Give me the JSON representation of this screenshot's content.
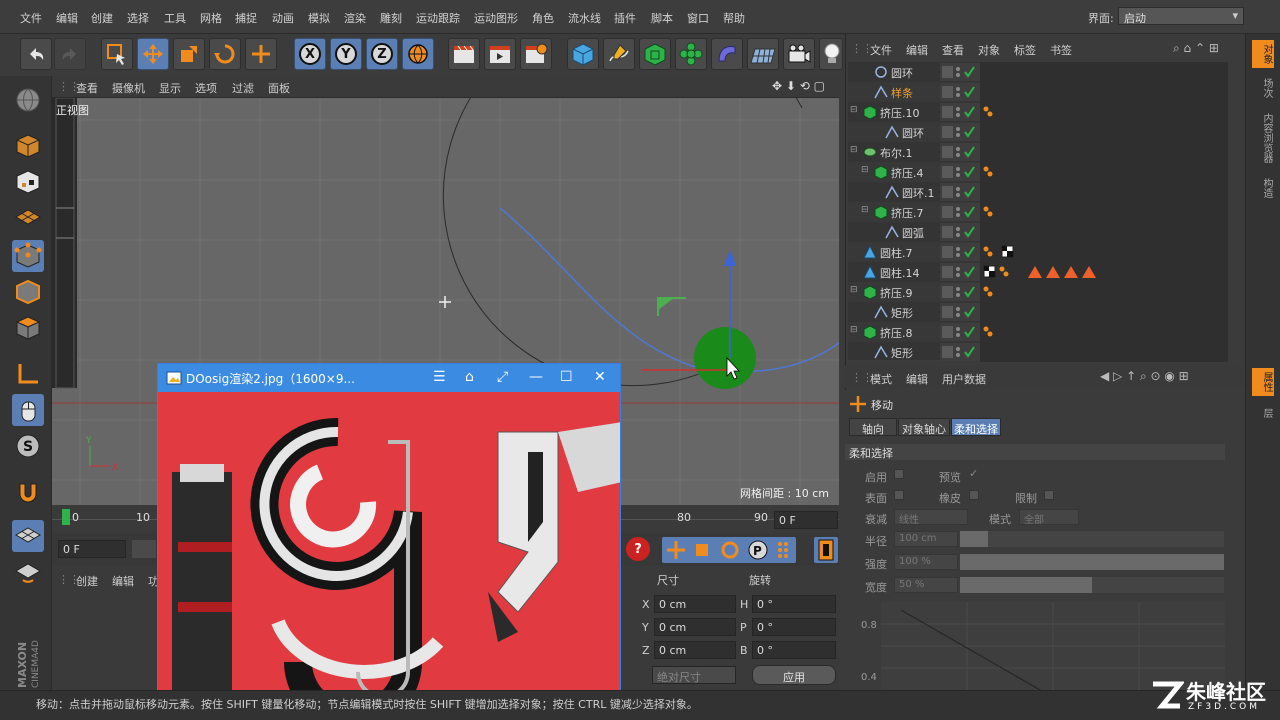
{
  "menubar": {
    "items": [
      "文件",
      "编辑",
      "创建",
      "选择",
      "工具",
      "网格",
      "捕捉",
      "动画",
      "模拟",
      "渲染",
      "雕刻",
      "运动跟踪",
      "运动图形",
      "角色",
      "流水线",
      "插件",
      "脚本",
      "窗口",
      "帮助"
    ],
    "interface_label": "界面:",
    "interface_value": "启动"
  },
  "toolbar": {
    "axes": [
      "X",
      "Y",
      "Z"
    ]
  },
  "viewport": {
    "menu": [
      "查看",
      "摄像机",
      "显示",
      "选项",
      "过滤",
      "面板"
    ],
    "view_name": "正视图",
    "grid_spacing": "网格间距 : 10 cm",
    "axis_y": "Y",
    "axis_x": "X"
  },
  "timeline": {
    "ticks": [
      "0",
      "10",
      "80",
      "90"
    ],
    "frame_field": "0 F",
    "start_field": "0 F"
  },
  "coord_manager": {
    "menu": [
      "创建",
      "编辑",
      "功"
    ],
    "col_size": "尺寸",
    "col_rotation": "旋转",
    "rows": [
      {
        "axis": "X",
        "size": "0 cm",
        "rot_axis": "H",
        "rot": "0 °"
      },
      {
        "axis": "Y",
        "size": "0 cm",
        "rot_axis": "P",
        "rot": "0 °"
      },
      {
        "axis": "Z",
        "size": "0 cm",
        "rot_axis": "B",
        "rot": "0 °"
      }
    ],
    "size_mode": "绝对尺寸",
    "apply": "应用"
  },
  "object_manager": {
    "menu": [
      "文件",
      "编辑",
      "查看",
      "对象",
      "标签",
      "书签"
    ],
    "objects": [
      {
        "name": "圆环",
        "indent": 1,
        "icon": "circle"
      },
      {
        "name": "样条",
        "indent": 1,
        "icon": "spline",
        "highlight": true
      },
      {
        "name": "挤压.10",
        "indent": 0,
        "icon": "extrude"
      },
      {
        "name": "圆环",
        "indent": 2,
        "icon": "spline"
      },
      {
        "name": "布尔.1",
        "indent": 0,
        "icon": "boole"
      },
      {
        "name": "挤压.4",
        "indent": 1,
        "icon": "extrude"
      },
      {
        "name": "圆环.1",
        "indent": 2,
        "icon": "spline"
      },
      {
        "name": "挤压.7",
        "indent": 1,
        "icon": "extrude"
      },
      {
        "name": "圆弧",
        "indent": 2,
        "icon": "spline"
      },
      {
        "name": "圆柱.7",
        "indent": 0,
        "icon": "cylinder"
      },
      {
        "name": "圆柱.14",
        "indent": 0,
        "icon": "cylinder"
      },
      {
        "name": "挤压.9",
        "indent": 0,
        "icon": "extrude"
      },
      {
        "name": "矩形",
        "indent": 1,
        "icon": "spline"
      },
      {
        "name": "挤压.8",
        "indent": 0,
        "icon": "extrude"
      },
      {
        "name": "矩形",
        "indent": 1,
        "icon": "spline"
      }
    ]
  },
  "attribute_manager": {
    "menu": [
      "模式",
      "编辑",
      "用户数据"
    ],
    "tool_name": "移动",
    "tabs": [
      "轴向",
      "对象轴心",
      "柔和选择"
    ],
    "active_tab": "柔和选择",
    "section": "柔和选择",
    "fields": {
      "enable": "启用",
      "preview": "预览",
      "surface": "表面",
      "rubber": "橡皮",
      "restrict": "限制",
      "falloff": "衰减",
      "falloff_value": "线性",
      "mode": "模式",
      "mode_value": "全部",
      "radius": "半径",
      "radius_value": "100 cm",
      "strength": "强度",
      "strength_value": "100 %",
      "width": "宽度",
      "width_value": "50 %"
    },
    "graph_labels": [
      "0.8",
      "0.4"
    ]
  },
  "right_tabs": [
    "对象",
    "场次",
    "内容浏览器",
    "构造",
    "属性",
    "层"
  ],
  "image_window": {
    "title": "DOosig渲染2.jpg（1600×9..."
  },
  "status": {
    "text": "移动：点击并拖动鼠标移动元素。按住 SHIFT 键量化移动；节点编辑模式时按住 SHIFT 键增加选择对象；按住 CTRL 键减少选择对象。"
  },
  "brand": {
    "maxon": "MAXON",
    "cinema": "CINEMA4D",
    "watermark": "朱峰社区",
    "watermark_url": "ZF3D.COM"
  },
  "colors": {
    "accent_blue": "#5b7fb5",
    "orange": "#f08c1e",
    "window_blue": "#3c8be2"
  }
}
